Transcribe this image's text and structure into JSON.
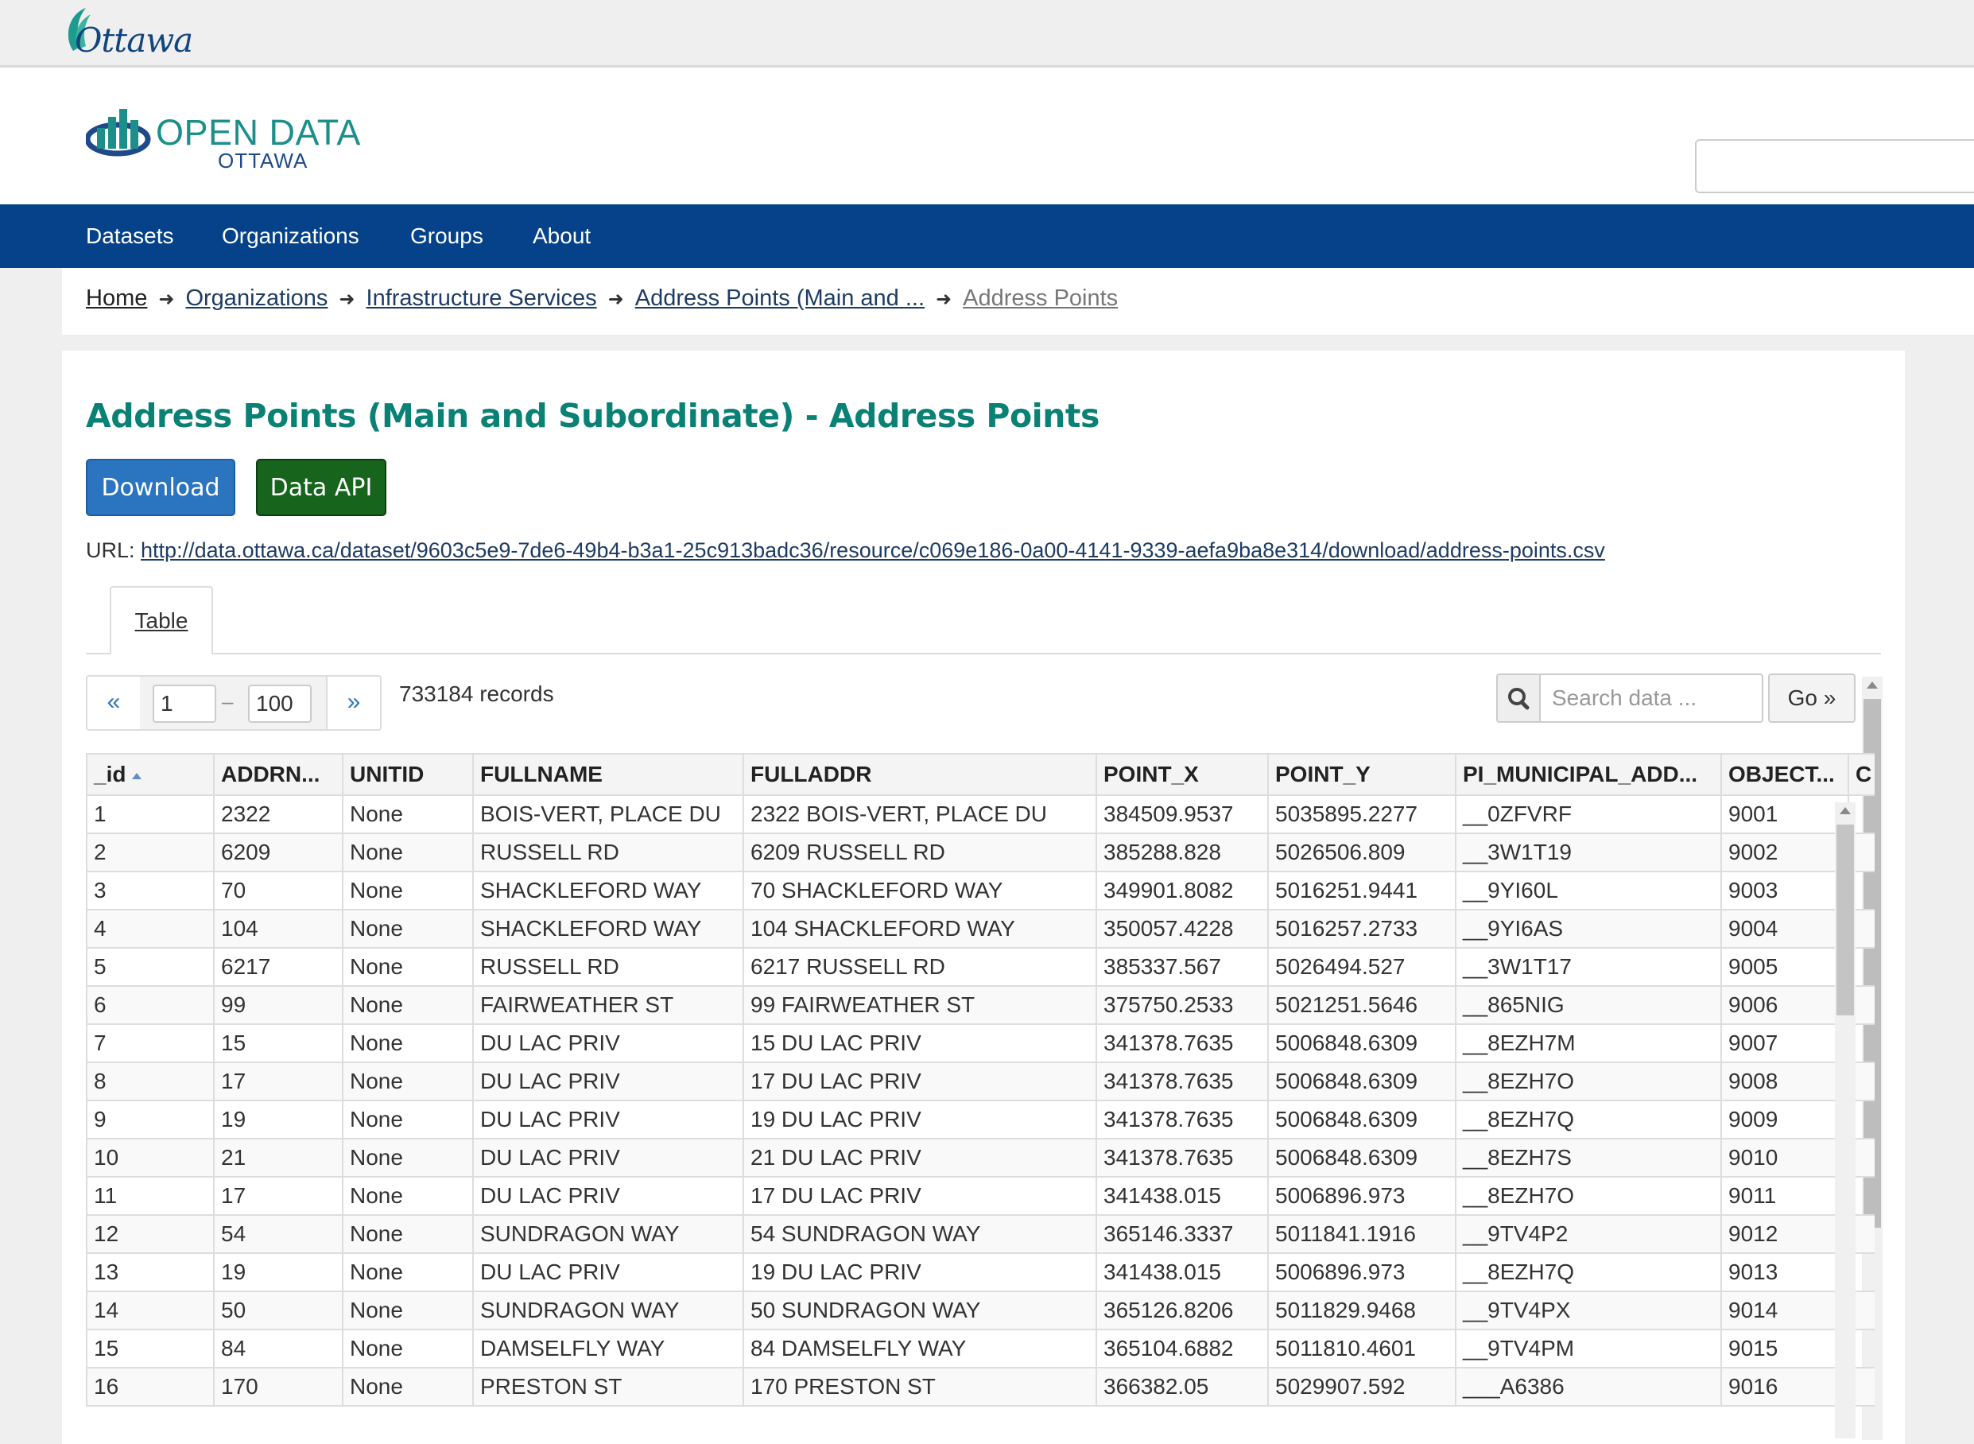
{
  "city": {
    "logo_text": "Ottawa"
  },
  "header": {
    "logo_main": "OPEN DATA",
    "logo_sub": "OTTAWA",
    "search_value": ""
  },
  "nav": {
    "items": [
      "Datasets",
      "Organizations",
      "Groups",
      "About"
    ]
  },
  "breadcrumb": [
    "Home",
    "Organizations",
    "Infrastructure Services",
    "Address Points (Main and ...",
    "Address Points"
  ],
  "page": {
    "title": "Address Points (Main and Subordinate) - Address Points",
    "download_label": "Download",
    "api_label": "Data API",
    "url_label": "URL:",
    "url": "http://data.ottawa.ca/dataset/9603c5e9-7de6-49b4-b3a1-25c913badc36/resource/c069e186-0a00-4141-9339-aefa9ba8e314/download/address-points.csv",
    "tab_label": "Table"
  },
  "pager": {
    "prev": "«",
    "next": "»",
    "from": "1",
    "to": "100",
    "dash": "–",
    "records": "733184 records"
  },
  "data_search": {
    "placeholder": "Search data ...",
    "go": "Go »"
  },
  "table": {
    "columns": [
      "_id",
      "ADDRN...",
      "UNITID",
      "FULLNAME",
      "FULLADDR",
      "POINT_X",
      "POINT_Y",
      "PI_MUNICIPAL_ADD...",
      "OBJECT...",
      "C"
    ],
    "rows": [
      [
        "1",
        "2322",
        "None",
        "BOIS-VERT, PLACE DU",
        "2322 BOIS-VERT, PLACE DU",
        "384509.9537",
        "5035895.2277",
        "__0ZFVRF",
        "9001"
      ],
      [
        "2",
        "6209",
        "None",
        "RUSSELL RD",
        "6209 RUSSELL RD",
        "385288.828",
        "5026506.809",
        "__3W1T19",
        "9002"
      ],
      [
        "3",
        "70",
        "None",
        "SHACKLEFORD WAY",
        "70 SHACKLEFORD WAY",
        "349901.8082",
        "5016251.9441",
        "__9YI60L",
        "9003"
      ],
      [
        "4",
        "104",
        "None",
        "SHACKLEFORD WAY",
        "104 SHACKLEFORD WAY",
        "350057.4228",
        "5016257.2733",
        "__9YI6AS",
        "9004"
      ],
      [
        "5",
        "6217",
        "None",
        "RUSSELL RD",
        "6217 RUSSELL RD",
        "385337.567",
        "5026494.527",
        "__3W1T17",
        "9005"
      ],
      [
        "6",
        "99",
        "None",
        "FAIRWEATHER ST",
        "99 FAIRWEATHER ST",
        "375750.2533",
        "5021251.5646",
        "__865NIG",
        "9006"
      ],
      [
        "7",
        "15",
        "None",
        "DU LAC PRIV",
        "15 DU LAC PRIV",
        "341378.7635",
        "5006848.6309",
        "__8EZH7M",
        "9007"
      ],
      [
        "8",
        "17",
        "None",
        "DU LAC PRIV",
        "17 DU LAC PRIV",
        "341378.7635",
        "5006848.6309",
        "__8EZH7O",
        "9008"
      ],
      [
        "9",
        "19",
        "None",
        "DU LAC PRIV",
        "19 DU LAC PRIV",
        "341378.7635",
        "5006848.6309",
        "__8EZH7Q",
        "9009"
      ],
      [
        "10",
        "21",
        "None",
        "DU LAC PRIV",
        "21 DU LAC PRIV",
        "341378.7635",
        "5006848.6309",
        "__8EZH7S",
        "9010"
      ],
      [
        "11",
        "17",
        "None",
        "DU LAC PRIV",
        "17 DU LAC PRIV",
        "341438.015",
        "5006896.973",
        "__8EZH7O",
        "9011"
      ],
      [
        "12",
        "54",
        "None",
        "SUNDRAGON WAY",
        "54 SUNDRAGON WAY",
        "365146.3337",
        "5011841.1916",
        "__9TV4P2",
        "9012"
      ],
      [
        "13",
        "19",
        "None",
        "DU LAC PRIV",
        "19 DU LAC PRIV",
        "341438.015",
        "5006896.973",
        "__8EZH7Q",
        "9013"
      ],
      [
        "14",
        "50",
        "None",
        "SUNDRAGON WAY",
        "50 SUNDRAGON WAY",
        "365126.8206",
        "5011829.9468",
        "__9TV4PX",
        "9014"
      ],
      [
        "15",
        "84",
        "None",
        "DAMSELFLY WAY",
        "84 DAMSELFLY WAY",
        "365104.6882",
        "5011810.4601",
        "__9TV4PM",
        "9015"
      ],
      [
        "16",
        "170",
        "None",
        "PRESTON ST",
        "170 PRESTON ST",
        "366382.05",
        "5029907.592",
        "___A6386",
        "9016"
      ]
    ]
  },
  "colors": {
    "nav_bg": "#05428a",
    "title": "#0a8175",
    "download_btn": "#2a74c0",
    "api_btn": "#17641d",
    "link": "#1e3c63"
  }
}
